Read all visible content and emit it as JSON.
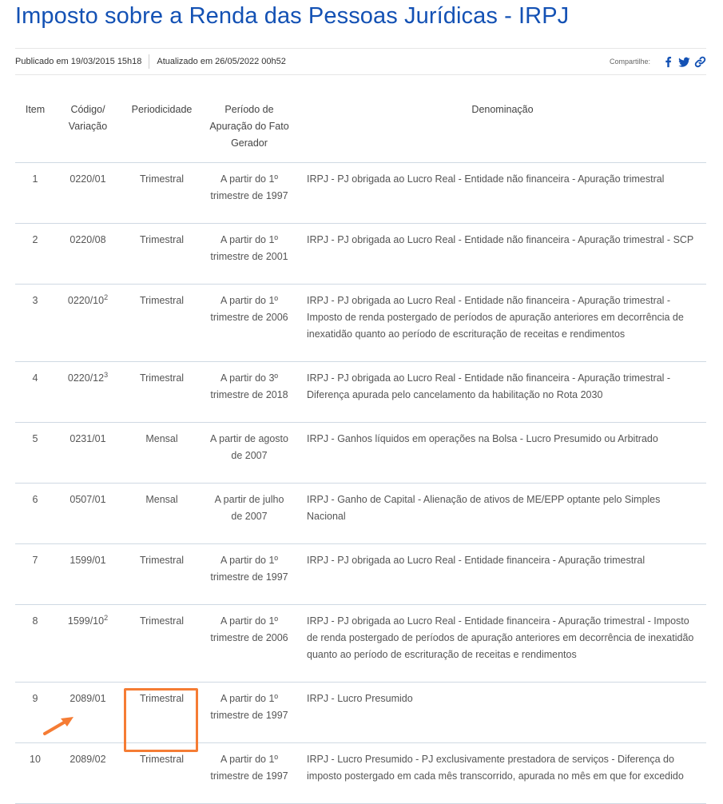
{
  "page": {
    "title": "Imposto sobre a Renda das Pessoas Jurídicas - IRPJ",
    "published": "Publicado em 19/03/2015 15h18",
    "updated": "Atualizado em 26/05/2022 00h52",
    "share_label": "Compartilhe:",
    "share_icons": [
      "facebook-icon",
      "twitter-icon",
      "link-icon"
    ],
    "accent_color": "#1351b4",
    "highlight_color": "#f57c34"
  },
  "table": {
    "headers": {
      "item": "Item",
      "codigo": "Código/ Variação",
      "periodicidade": "Periodicidade",
      "periodo": "Período de Apuração do Fato Gerador",
      "denominacao": "Denominação"
    },
    "rows": [
      {
        "item": "1",
        "codigo": "0220/01",
        "sup": "",
        "periodicidade": "Trimestral",
        "periodo": "A partir do 1º trimestre de 1997",
        "denominacao": "IRPJ - PJ obrigada ao Lucro Real - Entidade não financeira - Apuração trimestral"
      },
      {
        "item": "2",
        "codigo": "0220/08",
        "sup": "",
        "periodicidade": "Trimestral",
        "periodo": "A partir do 1º trimestre de 2001",
        "denominacao": "IRPJ - PJ obrigada ao Lucro Real - Entidade não financeira - Apuração trimestral - SCP"
      },
      {
        "item": "3",
        "codigo": "0220/10",
        "sup": "2",
        "periodicidade": "Trimestral",
        "periodo": "A partir do 1º trimestre de 2006",
        "denominacao": "IRPJ - PJ obrigada ao Lucro Real - Entidade não financeira - Apuração trimestral - Imposto de renda postergado de períodos de apuração anteriores em decorrência de inexatidão quanto ao período de escrituração de receitas e rendimentos"
      },
      {
        "item": "4",
        "codigo": "0220/12",
        "sup": "3",
        "periodicidade": "Trimestral",
        "periodo": "A partir do 3º trimestre de 2018",
        "denominacao": "IRPJ - PJ obrigada ao Lucro Real - Entidade não financeira - Apuração trimestral - Diferença apurada pelo cancelamento da habilitação no Rota 2030"
      },
      {
        "item": "5",
        "codigo": "0231/01",
        "sup": "",
        "periodicidade": "Mensal",
        "periodo": "A partir de agosto de 2007",
        "denominacao": "IRPJ - Ganhos líquidos em operações na Bolsa - Lucro Presumido ou Arbitrado"
      },
      {
        "item": "6",
        "codigo": "0507/01",
        "sup": "",
        "periodicidade": "Mensal",
        "periodo": "A partir de julho de 2007",
        "denominacao": "IRPJ - Ganho de Capital - Alienação de ativos de ME/EPP optante pelo Simples Nacional"
      },
      {
        "item": "7",
        "codigo": "1599/01",
        "sup": "",
        "periodicidade": "Trimestral",
        "periodo": "A partir do 1º trimestre de 1997",
        "denominacao": "IRPJ - PJ obrigada ao Lucro Real - Entidade financeira - Apuração trimestral"
      },
      {
        "item": "8",
        "codigo": "1599/10",
        "sup": "2",
        "periodicidade": "Trimestral",
        "periodo": "A partir do 1º trimestre de 2006",
        "denominacao": "IRPJ - PJ obrigada ao Lucro Real - Entidade financeira - Apuração trimestral - Imposto de renda postergado de períodos de apuração anteriores em decorrência de inexatidão quanto ao período de escrituração de receitas e rendimentos"
      },
      {
        "item": "9",
        "codigo": "2089/01",
        "sup": "",
        "periodicidade": "Trimestral",
        "periodo": "A partir do 1º trimestre de 1997",
        "denominacao": "IRPJ - Lucro Presumido"
      },
      {
        "item": "10",
        "codigo": "2089/02",
        "sup": "",
        "periodicidade": "Trimestral",
        "periodo": "A partir do 1º trimestre de 1997",
        "denominacao": "IRPJ - Lucro Presumido - PJ exclusivamente prestadora de serviços - Diferença do imposto postergado em cada mês transcorrido, apurada no mês em que for excedido"
      }
    ]
  }
}
